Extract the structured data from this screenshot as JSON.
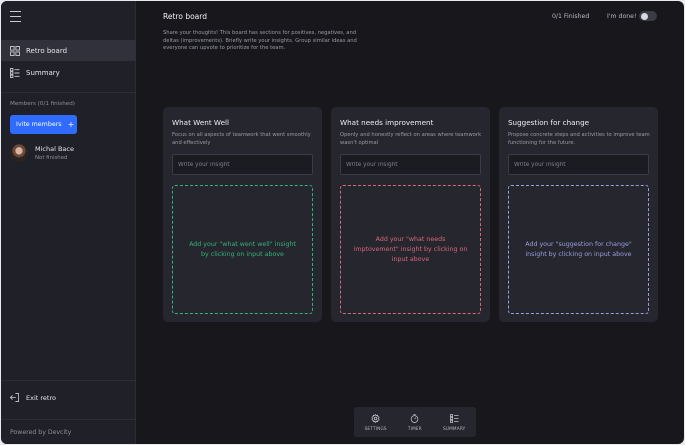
{
  "sidebar": {
    "nav": [
      {
        "label": "Retro board",
        "icon": "grid-icon",
        "active": true
      },
      {
        "label": "Summary",
        "icon": "checklist-icon",
        "active": false
      }
    ],
    "members_label": "Members (0/1 finished)",
    "invite_label": "Ivite members",
    "member": {
      "name": "Michal Bace",
      "status": "Not finished"
    },
    "exit_label": "Exit retro",
    "powered_by": "Powered by Devcity"
  },
  "header": {
    "title": "Retro board",
    "description": "Share your thoughts! This board has sections for positives, negatives, and deltas (improvements). Briefly write your insights.  Group similar ideas and everyone can upvote to prioritize for the team.",
    "finished": "0/1 Finished",
    "done_label": "I'm done!"
  },
  "columns": [
    {
      "title": "What Went Well",
      "description": "Focus on all aspects of teamwork that went smoothly and effectively",
      "placeholder": "Write your insight",
      "empty_text": "Add your \"what went well\" insight by clicking on input above",
      "color": "#35b27a"
    },
    {
      "title": "What needs improvement",
      "description": "Openly and honestly reflect on areas where teamwork wasn't optimal",
      "placeholder": "Write your insight",
      "empty_text": "Add your \"what needs imptovement\" insight by clicking on input above",
      "color": "#d9677a"
    },
    {
      "title": "Suggestion for change",
      "description": "Propose concrete steps and activities to improve team functioning for the future.",
      "placeholder": "Write your insight",
      "empty_text": "Add your \"suggestion for change\" insight by clicking on input above",
      "color": "#9a9fe0"
    }
  ],
  "toolbar": {
    "settings": "SETTINGS",
    "timer": "TIMER",
    "summary": "SUMMARY"
  }
}
